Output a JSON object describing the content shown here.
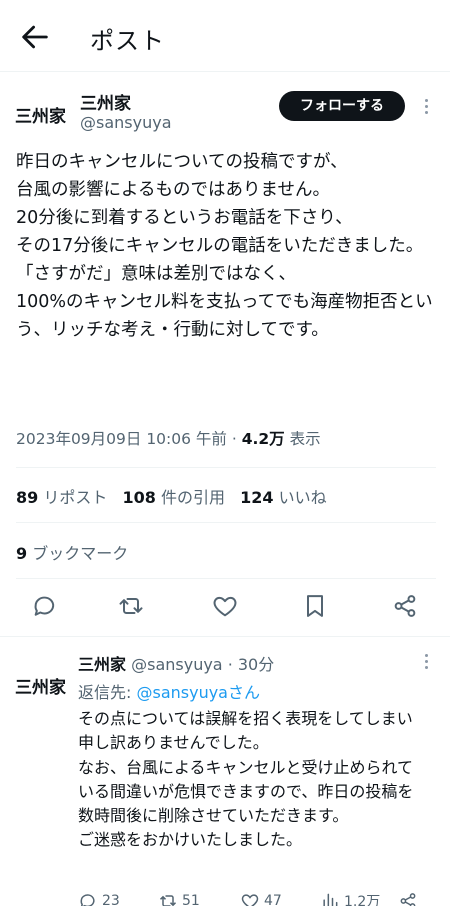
{
  "header": {
    "title": "ポスト",
    "back_icon": "arrow-left-icon"
  },
  "post": {
    "author_name": "三州家",
    "handle": "@sansyuya",
    "avatar_text": "三州家",
    "follow_label": "フォローする",
    "text": "昨日のキャンセルについての投稿ですが、\n台風の影響によるものではありません。\n20分後に到着するというお電話を下さり、\nその17分後にキャンセルの電話をいただきました。\n「さすがだ」意味は差別ではなく、\n100%のキャンセル料を支払ってでも海産物拒否という、リッチな考え・行動に対してです。",
    "timestamp": "2023年09月09日 10:06 午前",
    "views": "4.2万",
    "views_label": "表示",
    "stats": {
      "reposts": "89",
      "reposts_label": "リポスト",
      "quotes": "108",
      "quotes_label": "件の引用",
      "likes": "124",
      "likes_label": "いいね",
      "bookmarks": "9",
      "bookmarks_label": "ブックマーク"
    }
  },
  "reply": {
    "author_name": "三州家",
    "handle_time": "@sansyuya · 30分",
    "reply_to_prefix": "返信先: ",
    "reply_to_link": "@sansyuyaさん",
    "text": "その点については誤解を招く表現をしてしまい申し訳ありませんでした。\nなお、台風によるキャンセルと受け止められている間違いが危惧できますので、昨日の投稿を数時間後に削除させていただきます。\nご迷惑をおかけいたしました。",
    "counts": {
      "replies": "23",
      "reposts": "51",
      "likes": "47",
      "views": "1.2万"
    }
  },
  "colors": {
    "accent": "#1d9bf0",
    "secondary_text": "#536471",
    "primary_text": "#0f1419"
  }
}
